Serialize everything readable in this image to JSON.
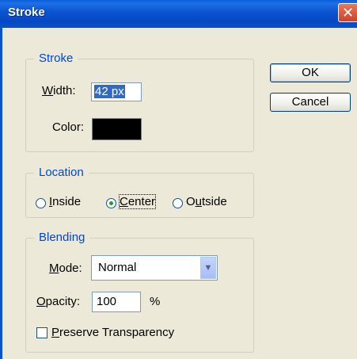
{
  "window": {
    "title": "Stroke",
    "close_glyph": "✕"
  },
  "stroke_group": {
    "legend": "Stroke",
    "width_label_mnemonic": "W",
    "width_label_rest": "idth:",
    "width_value": "42 px",
    "color_label": "Color:",
    "color_value": "#000000"
  },
  "location_group": {
    "legend": "Location",
    "options": [
      {
        "mnemonic": "I",
        "rest": "nside",
        "selected": false
      },
      {
        "mnemonic": "C",
        "rest": "enter",
        "selected": true
      },
      {
        "pre": "O",
        "mnemonic": "u",
        "rest": "tside",
        "selected": false
      }
    ]
  },
  "blending_group": {
    "legend": "Blending",
    "mode_label_mnemonic": "M",
    "mode_label_rest": "ode:",
    "mode_value": "Normal",
    "opacity_label_mnemonic": "O",
    "opacity_label_rest": "pacity:",
    "opacity_value": "100",
    "opacity_unit": "%",
    "preserve_label_mnemonic": "P",
    "preserve_label_rest": "reserve Transparency",
    "preserve_checked": false
  },
  "buttons": {
    "ok": "OK",
    "cancel": "Cancel"
  },
  "colors": {
    "title_bar": "#0a53cf",
    "group_label": "#0046d5",
    "dialog_bg": "#ece9d8"
  }
}
